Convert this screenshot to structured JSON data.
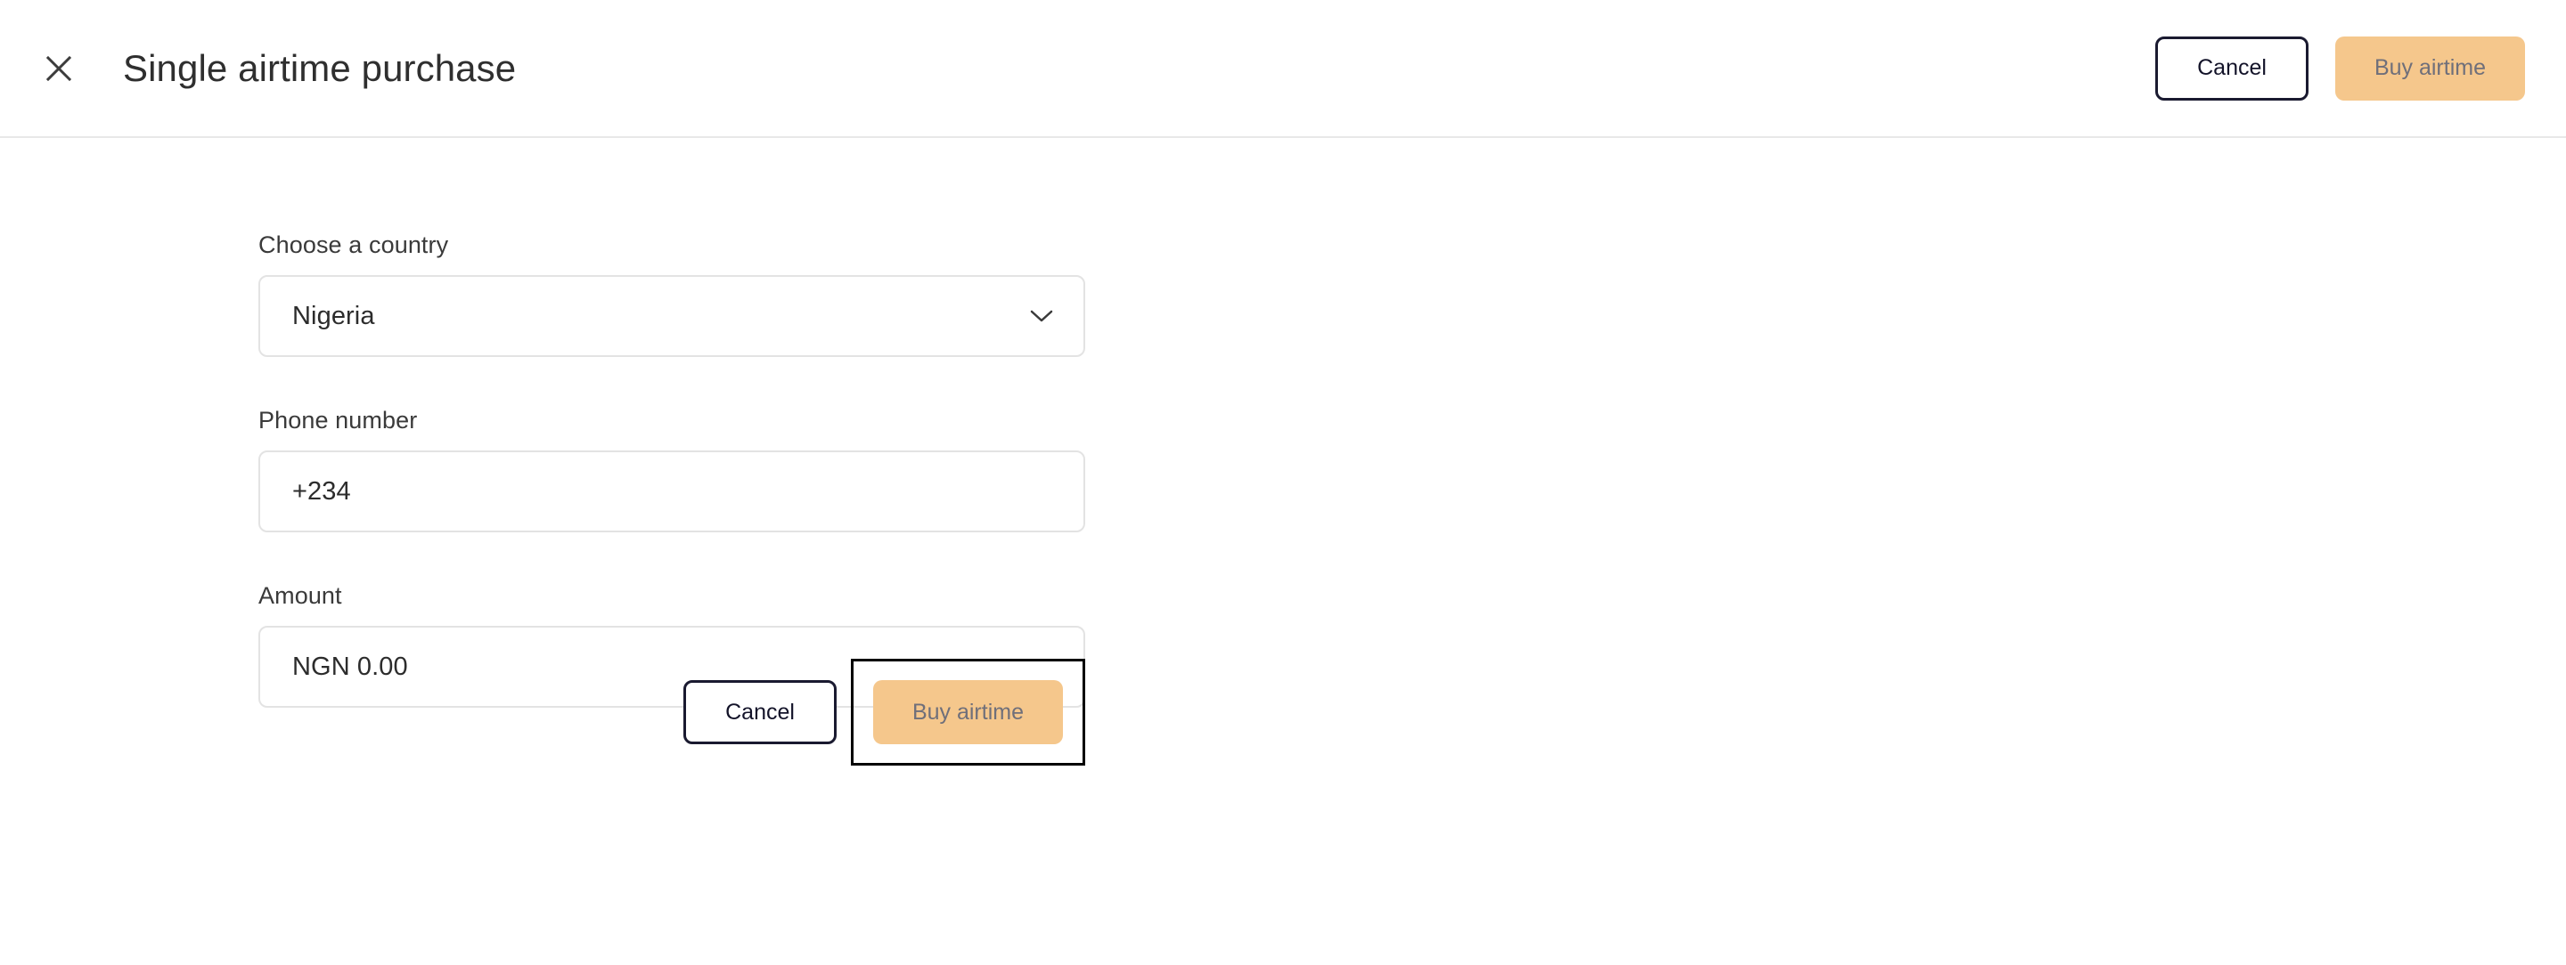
{
  "header": {
    "title": "Single airtime purchase",
    "close_icon": "close-icon",
    "cancel_label": "Cancel",
    "buy_label": "Buy airtime"
  },
  "form": {
    "country": {
      "label": "Choose a country",
      "value": "Nigeria",
      "chevron_icon": "chevron-down-icon"
    },
    "phone": {
      "label": "Phone number",
      "value": "+234"
    },
    "amount": {
      "label": "Amount",
      "value": "NGN 0.00"
    }
  },
  "footer": {
    "cancel_label": "Cancel",
    "buy_label": "Buy airtime"
  },
  "colors": {
    "accent_peach": "#f5c78c",
    "dark_navy": "#1a1a30",
    "disabled_text": "#6f6f7a",
    "border_grey": "#e3e3e3",
    "title_text": "#2f2f2f"
  }
}
